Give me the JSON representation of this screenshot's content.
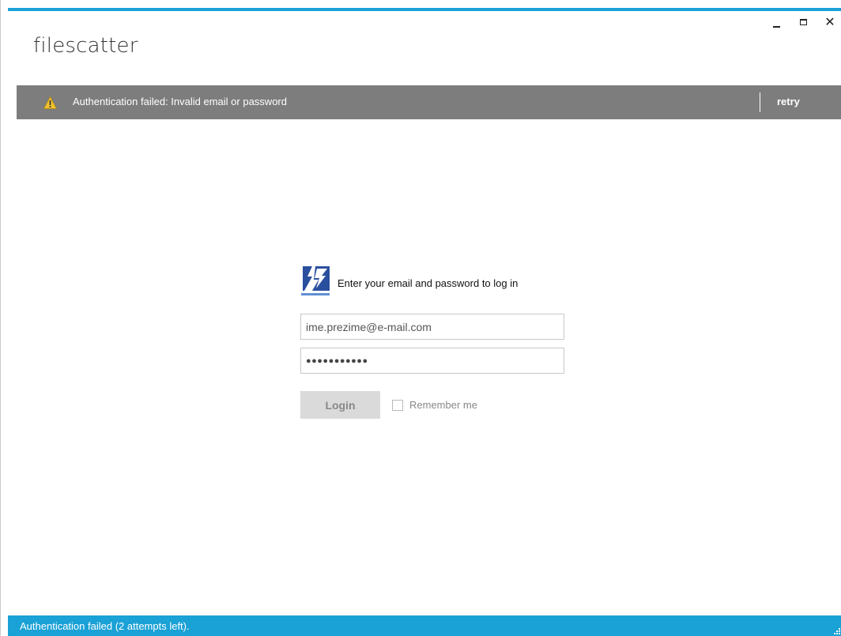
{
  "app": {
    "title": "filescatter"
  },
  "window_controls": {
    "minimize_icon": "minimize-icon",
    "maximize_icon": "maximize-icon",
    "close_icon": "close-icon",
    "close_glyph": "✕"
  },
  "error_banner": {
    "icon": "warning-icon",
    "message": "Authentication failed: Invalid email or password",
    "action_label": "retry",
    "background": "#7d7d7d"
  },
  "login": {
    "prompt": "Enter your email and password to log in",
    "email_value": "ime.prezime@e-mail.com",
    "password_value": "●●●●●●●●●●●",
    "login_label": "Login",
    "remember_label": "Remember me",
    "remember_checked": false
  },
  "status": {
    "text": "Authentication failed (2 attempts left)."
  },
  "colors": {
    "accent": "#1aa1d6",
    "banner": "#7d7d7d",
    "logo_dark": "#2a4f9e",
    "logo_light": "#5f8fd1"
  }
}
